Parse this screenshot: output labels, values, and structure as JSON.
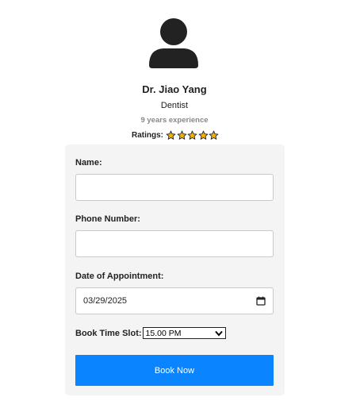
{
  "doctor": {
    "avatar_icon": "user-avatar-icon",
    "name": "Dr. Jiao Yang",
    "specialty": "Dentist",
    "experience": "9 years experience",
    "ratings_label": "Ratings:",
    "rating_stars": 5,
    "star_color": "#f5b400"
  },
  "form": {
    "name_label": "Name:",
    "name_value": "",
    "phone_label": "Phone Number:",
    "phone_value": "",
    "date_label": "Date of Appointment:",
    "date_value": "03/29/2025",
    "date_icon": "calendar-icon",
    "slot_label": "Book Time Slot:",
    "slot_value": "15.00 PM",
    "submit_label": "Book Now",
    "submit_color": "#0b84ff"
  }
}
